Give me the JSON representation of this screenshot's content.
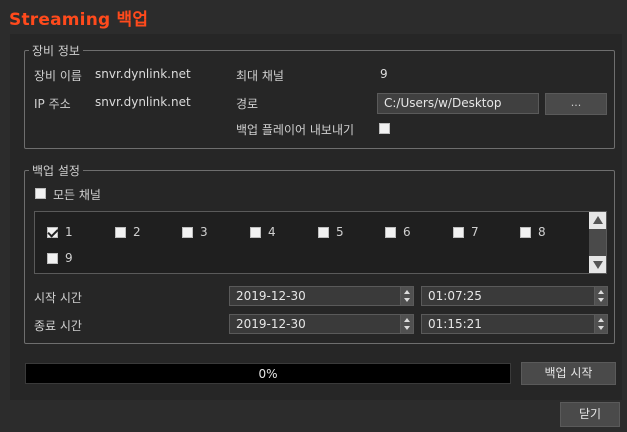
{
  "window": {
    "title": "Streaming 백업"
  },
  "device_info": {
    "legend": "장비 정보",
    "device_name_label": "장비 이름",
    "device_name_value": "snvr.dynlink.net",
    "ip_label": "IP 주소",
    "ip_value": "snvr.dynlink.net",
    "max_channels_label": "최대 채널",
    "max_channels_value": "9",
    "path_label": "경로",
    "path_value": "C:/Users/w/Desktop",
    "browse_label": "...",
    "export_player_label": "백업 플레이어 내보내기",
    "export_player_checked": false
  },
  "backup_settings": {
    "legend": "백업 설정",
    "all_channels_label": "모든 채널",
    "all_channels_checked": false,
    "channels": [
      {
        "label": "1",
        "checked": true
      },
      {
        "label": "2",
        "checked": false
      },
      {
        "label": "3",
        "checked": false
      },
      {
        "label": "4",
        "checked": false
      },
      {
        "label": "5",
        "checked": false
      },
      {
        "label": "6",
        "checked": false
      },
      {
        "label": "7",
        "checked": false
      },
      {
        "label": "8",
        "checked": false
      },
      {
        "label": "9",
        "checked": false
      }
    ],
    "start_time_label": "시작 시간",
    "start_date": "2019-12-30",
    "start_time": "01:07:25",
    "end_time_label": "종료 시간",
    "end_date": "2019-12-30",
    "end_time": "01:15:21"
  },
  "progress": {
    "percent": 0,
    "text": "0%"
  },
  "buttons": {
    "start_backup": "백업 시작",
    "close": "닫기"
  },
  "colors": {
    "title": "#ff4a1c",
    "background": "#2c2c2c",
    "panel": "#262626"
  }
}
